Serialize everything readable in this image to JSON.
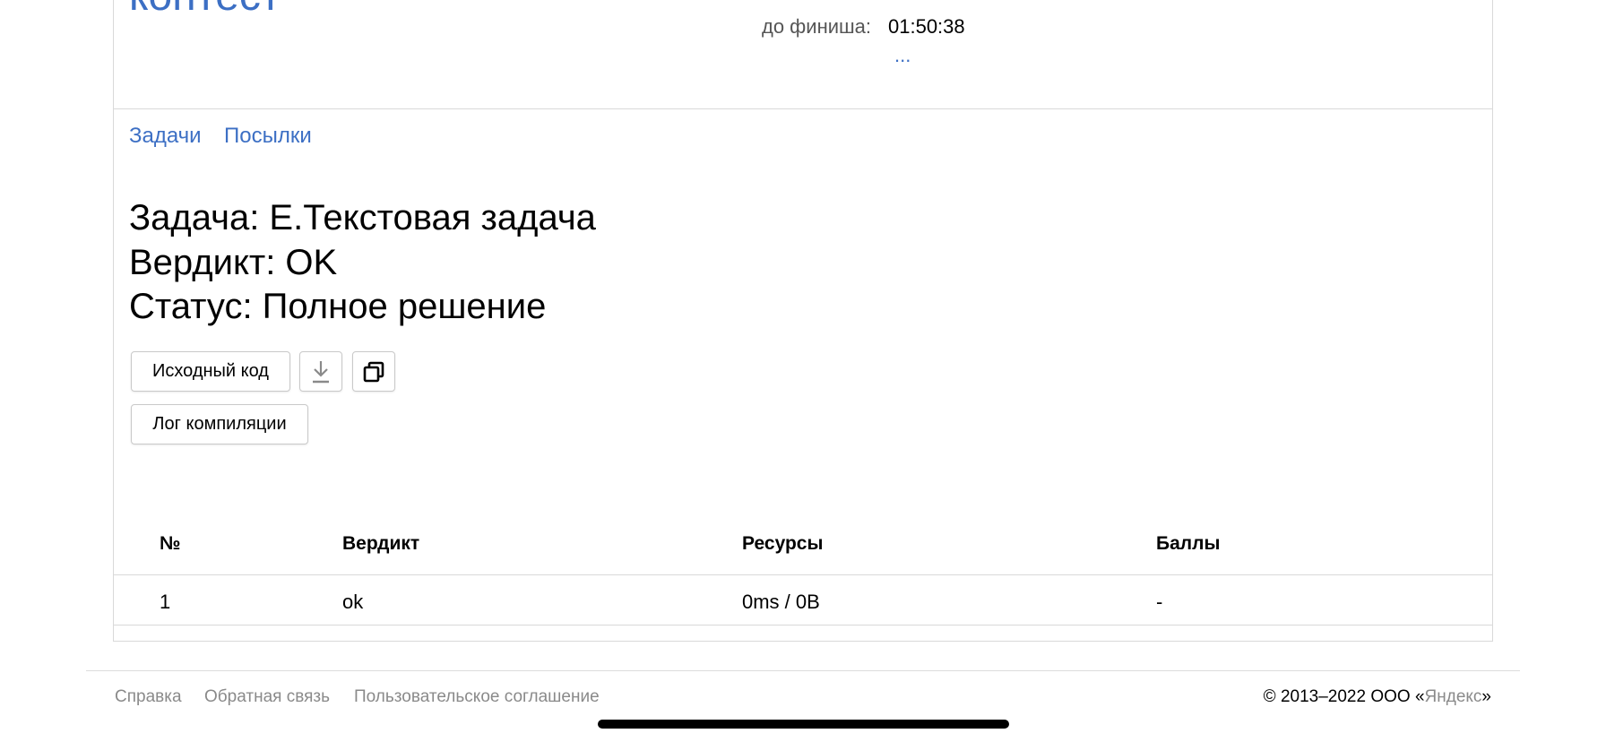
{
  "header": {
    "brand": "контест",
    "timer_label": "до финиша:",
    "timer_value": "01:50:38",
    "more": "..."
  },
  "nav": {
    "tasks": "Задачи",
    "submissions": "Посылки"
  },
  "submission": {
    "task_line": "Задача: E.Текстовая задача",
    "verdict_line": "Вердикт: OK",
    "status_line": "Статус: Полное решение"
  },
  "buttons": {
    "source_code": "Исходный код",
    "download_icon": "download-icon",
    "copy_icon": "copy-icon",
    "compile_log": "Лог компиляции"
  },
  "table": {
    "headers": [
      "№",
      "Вердикт",
      "Ресурсы",
      "Баллы"
    ],
    "rows": [
      [
        "1",
        "ok",
        "0ms / 0B",
        "-"
      ]
    ]
  },
  "footer": {
    "links": [
      "Справка",
      "Обратная связь",
      "Пользовательское соглашение"
    ],
    "copyright_prefix": "© 2013–2022  ООО «",
    "copyright_brand": "Яндекс",
    "copyright_suffix": "»"
  },
  "colors": {
    "link": "#3c6fc4",
    "border": "#d9d9d9",
    "muted": "#8a8a8a"
  }
}
